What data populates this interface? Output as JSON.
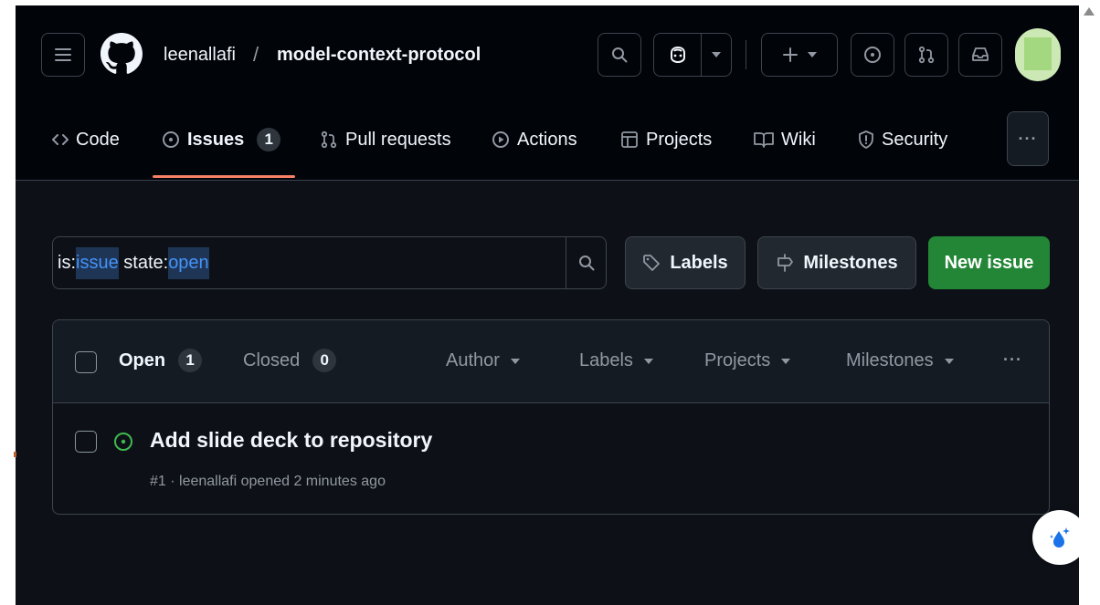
{
  "header": {
    "owner": "leenallafi",
    "separator": "/",
    "repo": "model-context-protocol"
  },
  "nav": {
    "code": "Code",
    "issues": "Issues",
    "issues_count": "1",
    "pulls": "Pull requests",
    "actions": "Actions",
    "projects": "Projects",
    "wiki": "Wiki",
    "security": "Security",
    "more": "···"
  },
  "filter": {
    "query_prefix": "is:",
    "query_qualifier": "issue",
    "query_middle": " state:",
    "query_value": "open",
    "labels_button": "Labels",
    "milestones_button": "Milestones",
    "new_issue_button": "New issue"
  },
  "list": {
    "open_label": "Open",
    "open_count": "1",
    "closed_label": "Closed",
    "closed_count": "0",
    "author_filter": "Author",
    "labels_filter": "Labels",
    "projects_filter": "Projects",
    "milestones_filter": "Milestones",
    "more": "···"
  },
  "issues": [
    {
      "title": "Add slide deck to repository",
      "meta": "#1 · leenallafi opened 2 minutes ago"
    }
  ],
  "colors": {
    "background": "#0d1117",
    "header": "#010409",
    "accent_underline": "#f78166",
    "primary_button": "#238636",
    "open_icon": "#3fb950",
    "link": "#4493f8"
  },
  "icons": [
    "hamburger-icon",
    "github-logo-icon",
    "search-icon",
    "copilot-icon",
    "plus-icon",
    "issue-opened-icon",
    "pull-request-icon",
    "inbox-icon",
    "code-icon",
    "play-icon",
    "table-icon",
    "book-icon",
    "shield-icon",
    "tag-icon",
    "milestone-icon",
    "kebab-icon"
  ]
}
